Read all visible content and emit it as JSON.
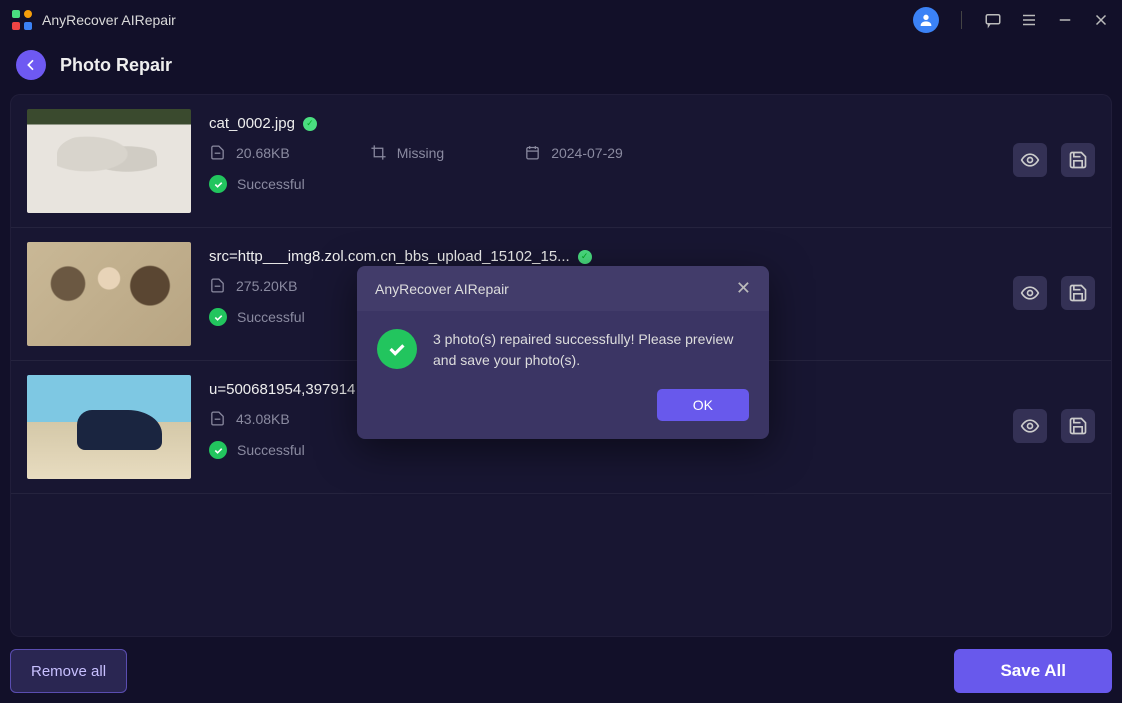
{
  "app": {
    "title": "AnyRecover AIRepair"
  },
  "page": {
    "title": "Photo Repair"
  },
  "items": [
    {
      "name": "cat_0002.jpg",
      "size": "20.68KB",
      "dimensions": "Missing",
      "date": "2024-07-29",
      "status": "Successful"
    },
    {
      "name": "src=http___img8.zol.com.cn_bbs_upload_15102_15...",
      "size": "275.20KB",
      "dimensions": "",
      "date": "",
      "status": "Successful"
    },
    {
      "name": "u=500681954,397914",
      "size": "43.08KB",
      "dimensions": "",
      "date": "",
      "status": "Successful"
    }
  ],
  "modal": {
    "title": "AnyRecover AIRepair",
    "message": "3 photo(s) repaired successfully! Please preview and save your photo(s).",
    "ok": "OK"
  },
  "footer": {
    "remove": "Remove all",
    "save": "Save All"
  }
}
